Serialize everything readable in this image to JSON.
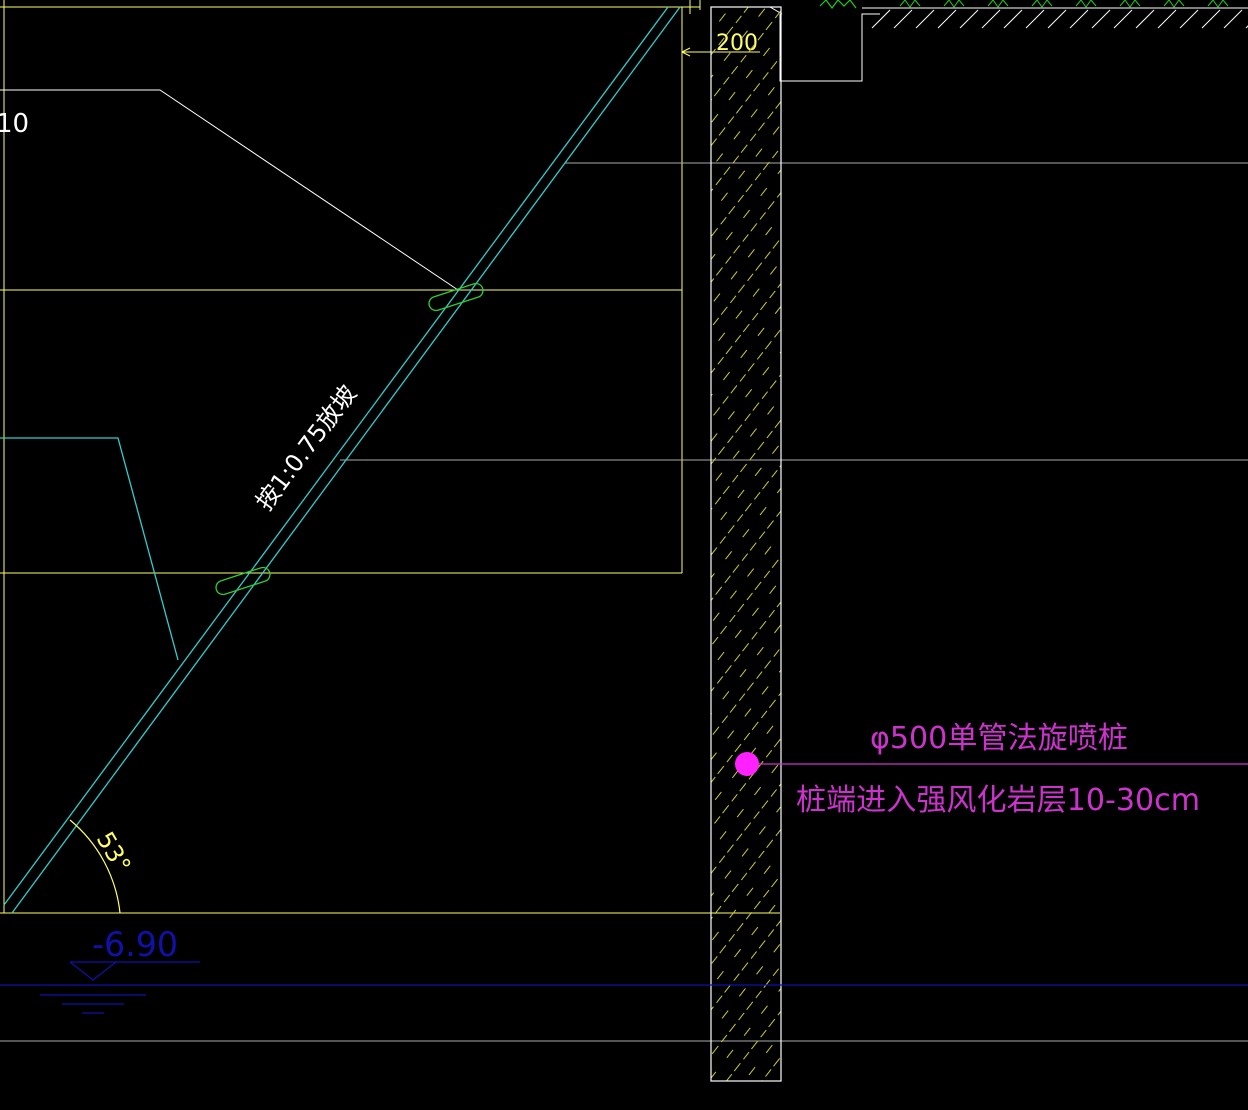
{
  "colors": {
    "background": "#000000",
    "boundary": "#ffff66",
    "slope": "#33cccc",
    "anchor": "#33cc33",
    "pile_hatch": "#cccc33",
    "annotation_pile": "#cc33cc",
    "water_level": "#1111aa",
    "grey_line": "#aaaaaa",
    "white_line": "#ffffff",
    "grass": "#22cc22"
  },
  "labels": {
    "slope_ratio": "按1:0.75放坡",
    "angle": "53°",
    "dim_200": "200",
    "partial_left": "10",
    "elevation": "-6.90",
    "pile_spec": "φ500单管法旋喷桩",
    "pile_note": "桩端进入强风化岩层10-30cm"
  }
}
